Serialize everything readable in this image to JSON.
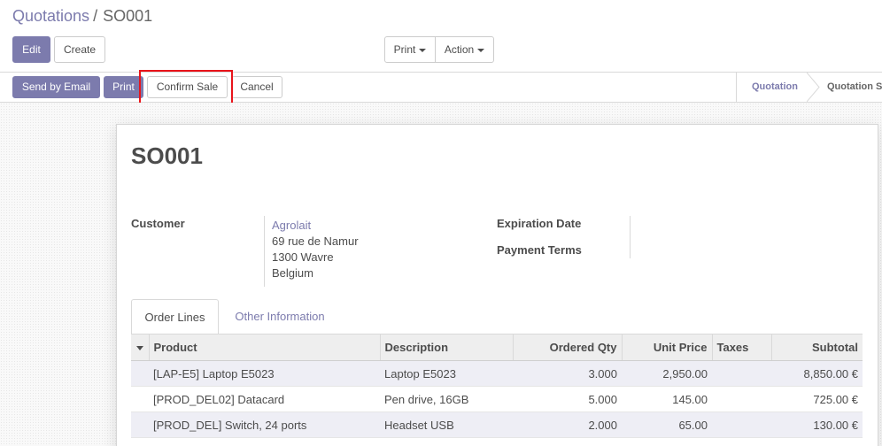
{
  "breadcrumb": {
    "parent": "Quotations",
    "separator": "/",
    "current": "SO001"
  },
  "toolbar": {
    "edit_label": "Edit",
    "create_label": "Create",
    "print_label": "Print",
    "action_label": "Action"
  },
  "statusbar": {
    "send_email_label": "Send by Email",
    "print_label": "Print",
    "confirm_sale_label": "Confirm Sale",
    "cancel_label": "Cancel",
    "stages": [
      "Quotation",
      "Quotation S"
    ],
    "active_stage": "Quotation"
  },
  "form": {
    "title": "SO001",
    "customer_label": "Customer",
    "customer_name": "Agrolait",
    "address": [
      "69 rue de Namur",
      "1300 Wavre",
      "Belgium"
    ],
    "expiration_date_label": "Expiration Date",
    "expiration_date_value": "",
    "payment_terms_label": "Payment Terms",
    "payment_terms_value": ""
  },
  "tabs": [
    {
      "label": "Order Lines",
      "active": true
    },
    {
      "label": "Other Information",
      "active": false
    }
  ],
  "table": {
    "columns": [
      "",
      "Product",
      "Description",
      "Ordered Qty",
      "Unit Price",
      "Taxes",
      "Subtotal"
    ],
    "rows": [
      {
        "product": "[LAP-E5] Laptop E5023",
        "description": "Laptop E5023",
        "qty": "3.000",
        "unit_price": "2,950.00",
        "taxes": "",
        "subtotal": "8,850.00 €"
      },
      {
        "product": "[PROD_DEL02] Datacard",
        "description": "Pen drive, 16GB",
        "qty": "5.000",
        "unit_price": "145.00",
        "taxes": "",
        "subtotal": "725.00 €"
      },
      {
        "product": "[PROD_DEL] Switch, 24 ports",
        "description": "Headset USB",
        "qty": "2.000",
        "unit_price": "65.00",
        "taxes": "",
        "subtotal": "130.00 €"
      }
    ]
  },
  "colors": {
    "brand": "#7c7bad",
    "highlight": "#e8141b",
    "text": "#4c4c4c"
  }
}
